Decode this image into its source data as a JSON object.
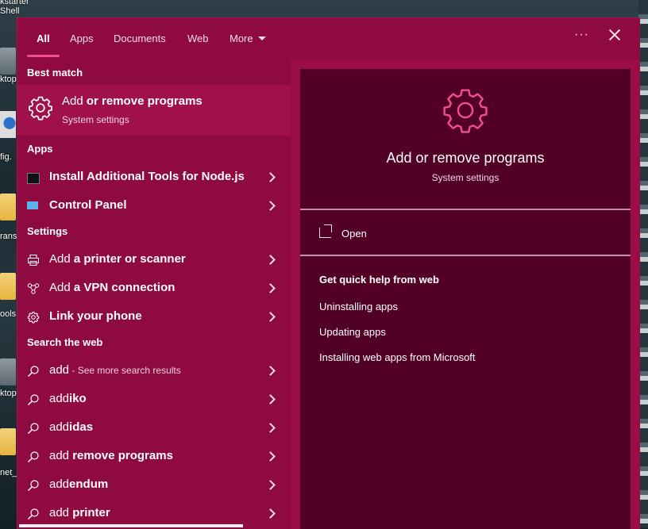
{
  "desktop": {
    "labels": [
      "kstarter",
      "Shell",
      "ktop",
      "fig.",
      "rans",
      "ools",
      "ktop",
      "net_"
    ]
  },
  "tabs": [
    {
      "label": "All"
    },
    {
      "label": "Apps"
    },
    {
      "label": "Documents"
    },
    {
      "label": "Web"
    },
    {
      "label": "More"
    }
  ],
  "toolbar": {
    "more_options": "···"
  },
  "sections": {
    "best_match": "Best match",
    "apps": "Apps",
    "settings": "Settings",
    "search_web": "Search the web"
  },
  "best_match": {
    "title_light": "Add",
    "title_bold": "or remove programs",
    "subtitle": "System settings"
  },
  "apps": [
    {
      "bold": "Install Additional Tools for Node.js",
      "icon": "terminal-icon"
    },
    {
      "bold": "Control Panel",
      "icon": "control-panel-icon"
    }
  ],
  "settings": [
    {
      "light": "Add",
      "bold": "a printer or scanner",
      "icon": "printer-icon"
    },
    {
      "light": "Add",
      "bold": "a VPN connection",
      "icon": "vpn-icon"
    },
    {
      "bold": "Link your phone",
      "icon": "gear-icon"
    }
  ],
  "web": [
    {
      "light": "add",
      "small": " - See more search results"
    },
    {
      "light": "add",
      "bold": "iko"
    },
    {
      "light": "add",
      "bold": "idas"
    },
    {
      "light": "add",
      "bold": " remove programs"
    },
    {
      "light": "add",
      "bold": "endum"
    },
    {
      "light": "add",
      "bold": " printer"
    }
  ],
  "preview": {
    "title": "Add or remove programs",
    "subtitle": "System settings",
    "open_label": "Open",
    "help_title": "Get quick help from web",
    "help_links": [
      "Uninstalling apps",
      "Updating apps",
      "Installing web apps from Microsoft"
    ]
  },
  "colors": {
    "accent": "#f24f8c",
    "panel": "#8e0a40",
    "preview_bg": "#520025"
  }
}
